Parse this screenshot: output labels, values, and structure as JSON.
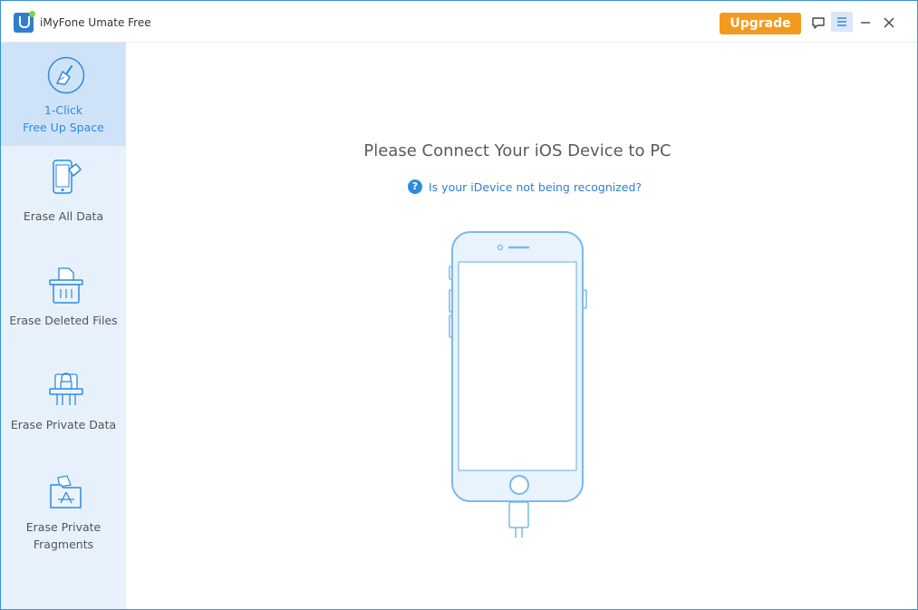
{
  "window": {
    "title": "iMyFone Umate Free",
    "accent_color": "#2f8ae0",
    "upgrade_color": "#f39a1e"
  },
  "toolbar": {
    "upgrade_label": "Upgrade",
    "icons": [
      "feedback-icon",
      "menu-icon",
      "minimize-icon",
      "close-icon"
    ]
  },
  "sidebar": {
    "items": [
      {
        "id": "free-up-space",
        "label_line1": "1-Click",
        "label_line2": "Free Up Space",
        "icon": "broom-icon",
        "active": true
      },
      {
        "id": "erase-all-data",
        "label_line1": "Erase All Data",
        "icon": "phone-eraser-icon",
        "active": false
      },
      {
        "id": "erase-deleted-files",
        "label_line1": "Erase Deleted Files",
        "icon": "trash-file-icon",
        "active": false
      },
      {
        "id": "erase-private-data",
        "label_line1": "Erase Private Data",
        "icon": "lock-shredder-icon",
        "active": false
      },
      {
        "id": "erase-private-fragments",
        "label_line1": "Erase Private",
        "label_line2": "Fragments",
        "icon": "folder-fragments-icon",
        "active": false
      }
    ]
  },
  "main": {
    "heading": "Please Connect Your iOS Device to PC",
    "help_icon_glyph": "?",
    "help_link": "Is your iDevice not being recognized?",
    "illustration": "iphone-with-cable-icon"
  }
}
